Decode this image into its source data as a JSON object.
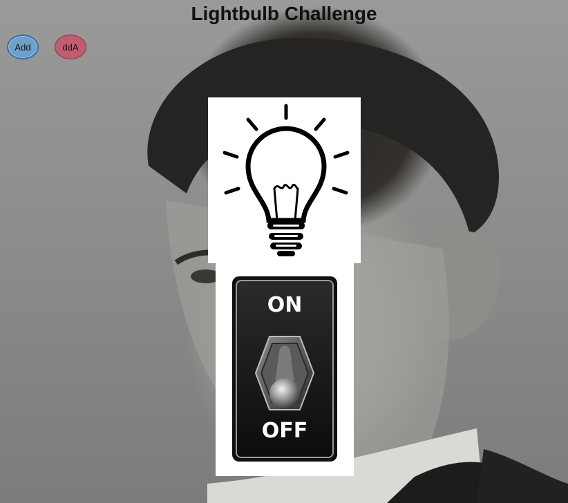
{
  "page": {
    "title": "Lightbulb Challenge"
  },
  "buttons": {
    "add_label": "Add",
    "dda_label": "ddA"
  },
  "switch": {
    "on_label": "ON",
    "off_label": "OFF"
  },
  "icons": {
    "bulb": "lightbulb-icon",
    "switch": "toggle-switch-icon"
  },
  "colors": {
    "add_button": "#6fa0c8",
    "dda_button": "#c25c70"
  }
}
